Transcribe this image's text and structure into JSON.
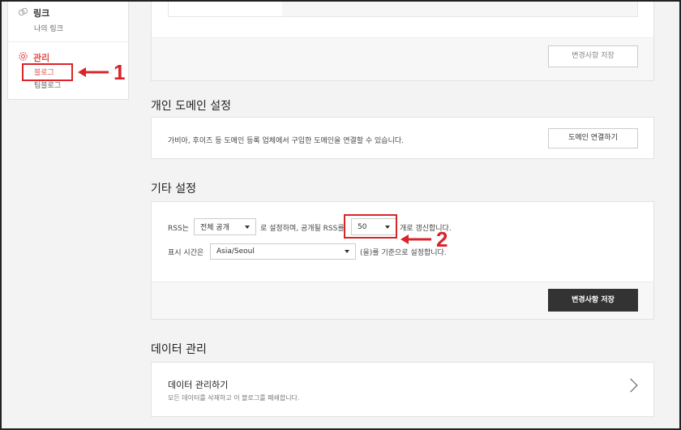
{
  "sidebar": {
    "link": {
      "title": "링크",
      "sub": "나의 링크",
      "icon": "link-icon"
    },
    "manage": {
      "title": "관리",
      "blog": "블로그",
      "team": "팀블로그",
      "icon": "gear-icon"
    }
  },
  "annotations": {
    "marker1": "1",
    "marker2": "2",
    "color": "#d9242a"
  },
  "top_card": {
    "save_label": "변경사항 저장"
  },
  "domain": {
    "title": "개인 도메인 설정",
    "description": "가비아, 후이즈 등 도메인 등록 업체에서 구입한 도메인을 연결할 수 있습니다.",
    "connect_label": "도메인 연결하기"
  },
  "other": {
    "title": "기타 설정",
    "rss_prefix": "RSS는",
    "rss_visibility": "전체 공개",
    "rss_middle": "로 설정하며, 공개될 RSS를",
    "rss_count": "50",
    "rss_suffix": "개로 갱신합니다.",
    "time_prefix": "표시 시간은",
    "timezone": "Asia/Seoul",
    "time_suffix": "(을)를 기준으로 설정합니다.",
    "save_label": "변경사항 저장"
  },
  "data": {
    "title": "데이터 관리",
    "item_title": "데이터 관리하기",
    "item_desc": "모든 데이터를 삭제하고 이 블로그를 폐쇄합니다."
  }
}
